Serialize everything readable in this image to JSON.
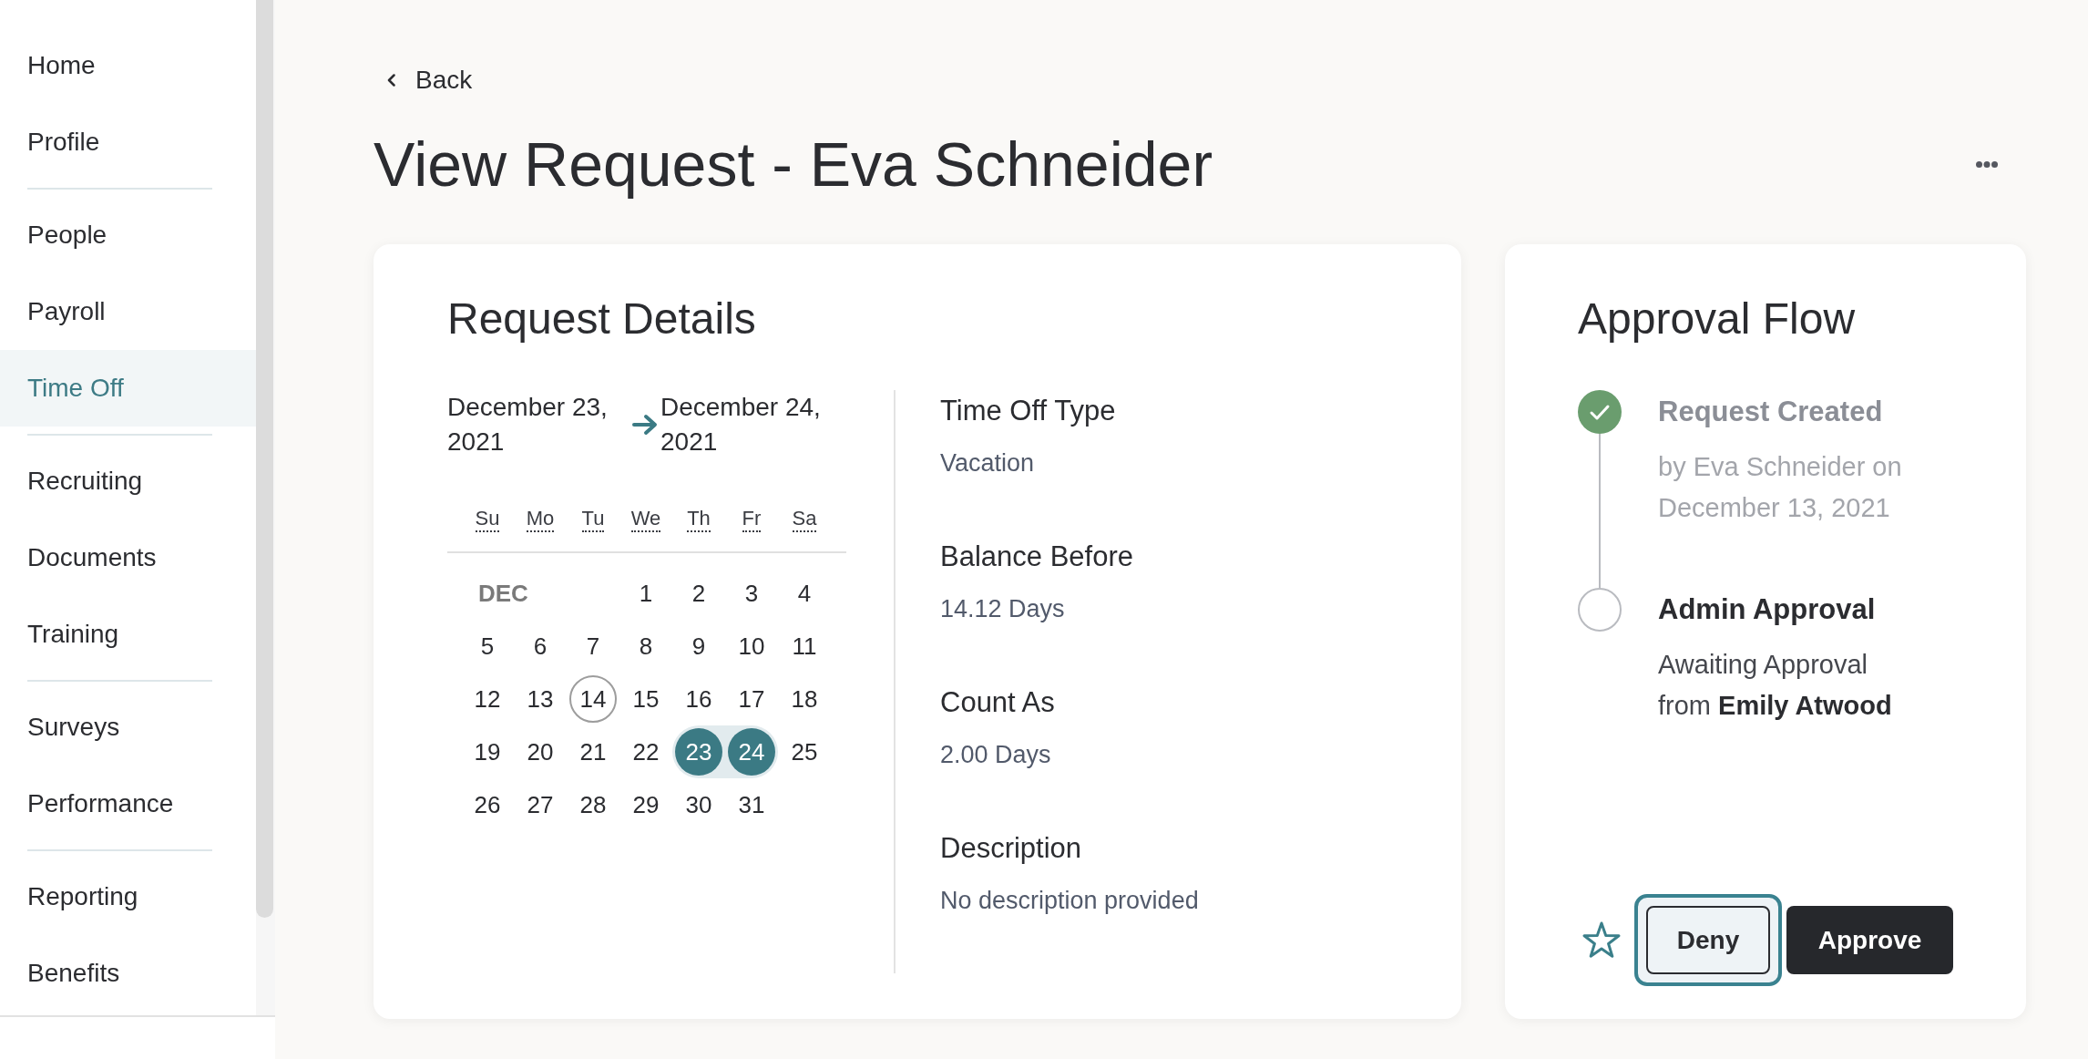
{
  "sidebar": {
    "groups": [
      {
        "items": [
          {
            "label": "Home",
            "selected": false
          },
          {
            "label": "Profile",
            "selected": false
          }
        ]
      },
      {
        "items": [
          {
            "label": "People",
            "selected": false
          },
          {
            "label": "Payroll",
            "selected": false
          },
          {
            "label": "Time Off",
            "selected": true
          }
        ]
      },
      {
        "items": [
          {
            "label": "Recruiting",
            "selected": false
          },
          {
            "label": "Documents",
            "selected": false
          },
          {
            "label": "Training",
            "selected": false
          }
        ]
      },
      {
        "items": [
          {
            "label": "Surveys",
            "selected": false
          },
          {
            "label": "Performance",
            "selected": false
          }
        ]
      },
      {
        "items": [
          {
            "label": "Reporting",
            "selected": false
          },
          {
            "label": "Benefits",
            "selected": false
          }
        ]
      }
    ]
  },
  "back": {
    "label": "Back"
  },
  "page_title": "View Request - Eva Schneider",
  "request_details": {
    "title": "Request Details",
    "start_date": "December 23, 2021",
    "end_date": "December 24, 2021",
    "calendar": {
      "weekdays": [
        "Su",
        "Mo",
        "Tu",
        "We",
        "Th",
        "Fr",
        "Sa"
      ],
      "month_label": "DEC",
      "weeks": [
        [
          {
            "day": "1",
            "selected": false,
            "today": false
          },
          {
            "day": "2",
            "selected": false,
            "today": false
          },
          {
            "day": "3",
            "selected": false,
            "today": false
          },
          {
            "day": "4",
            "selected": false,
            "today": false
          }
        ],
        [
          {
            "day": "5",
            "selected": false,
            "today": false
          },
          {
            "day": "6",
            "selected": false,
            "today": false
          },
          {
            "day": "7",
            "selected": false,
            "today": false
          },
          {
            "day": "8",
            "selected": false,
            "today": false
          },
          {
            "day": "9",
            "selected": false,
            "today": false
          },
          {
            "day": "10",
            "selected": false,
            "today": false
          },
          {
            "day": "11",
            "selected": false,
            "today": false
          }
        ],
        [
          {
            "day": "12",
            "selected": false,
            "today": false
          },
          {
            "day": "13",
            "selected": false,
            "today": false
          },
          {
            "day": "14",
            "selected": false,
            "today": true
          },
          {
            "day": "15",
            "selected": false,
            "today": false
          },
          {
            "day": "16",
            "selected": false,
            "today": false
          },
          {
            "day": "17",
            "selected": false,
            "today": false
          },
          {
            "day": "18",
            "selected": false,
            "today": false
          }
        ],
        [
          {
            "day": "19",
            "selected": false,
            "today": false
          },
          {
            "day": "20",
            "selected": false,
            "today": false
          },
          {
            "day": "21",
            "selected": false,
            "today": false
          },
          {
            "day": "22",
            "selected": false,
            "today": false
          },
          {
            "day": "23",
            "selected": true,
            "today": false
          },
          {
            "day": "24",
            "selected": true,
            "today": false
          },
          {
            "day": "25",
            "selected": false,
            "today": false
          }
        ],
        [
          {
            "day": "26",
            "selected": false,
            "today": false
          },
          {
            "day": "27",
            "selected": false,
            "today": false
          },
          {
            "day": "28",
            "selected": false,
            "today": false
          },
          {
            "day": "29",
            "selected": false,
            "today": false
          },
          {
            "day": "30",
            "selected": false,
            "today": false
          },
          {
            "day": "31",
            "selected": false,
            "today": false
          }
        ]
      ]
    },
    "fields": [
      {
        "label": "Time Off Type",
        "value": "Vacation"
      },
      {
        "label": "Balance Before",
        "value": "14.12 Days"
      },
      {
        "label": "Count As",
        "value": "2.00 Days"
      },
      {
        "label": "Description",
        "value": "No description provided"
      }
    ]
  },
  "approval_flow": {
    "title": "Approval Flow",
    "steps": [
      {
        "title": "Request Created",
        "completed": true,
        "detail": "by Eva Schneider on December 13, 2021"
      },
      {
        "title": "Admin Approval",
        "completed": false,
        "detail": "Awaiting Approval from **Emily Atwood**"
      }
    ],
    "buttons": [
      {
        "label": "Deny",
        "kind": "secondary",
        "focused": true
      },
      {
        "label": "Approve",
        "kind": "primary",
        "focused": false
      }
    ]
  }
}
